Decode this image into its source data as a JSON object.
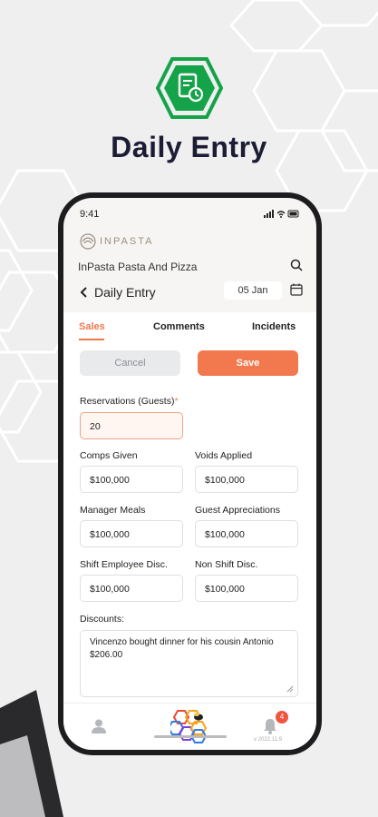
{
  "hero": {
    "title": "Daily Entry",
    "icon": "document-clock-icon",
    "accent_color": "#15a34a"
  },
  "status_bar": {
    "time": "9:41",
    "system_icons": "signal-wifi-battery"
  },
  "brand": {
    "name": "INPASTA",
    "logo": "inpasta-logo"
  },
  "header": {
    "restaurant_name": "InPasta Pasta And Pizza",
    "search_icon": "search-icon"
  },
  "nav": {
    "back_icon": "chevron-left-icon",
    "title": "Daily Entry",
    "date": "05 Jan",
    "calendar_icon": "calendar-icon"
  },
  "tabs": [
    {
      "label": "Sales",
      "active": true
    },
    {
      "label": "Comments",
      "active": false
    },
    {
      "label": "Incidents",
      "active": false
    }
  ],
  "actions": {
    "cancel_label": "Cancel",
    "save_label": "Save"
  },
  "form": {
    "reservations_label": "Reservations (Guests)",
    "reservations_required": "*",
    "reservations_value": "20",
    "comps_label": "Comps Given",
    "comps_value": "$100,000",
    "voids_label": "Voids Applied",
    "voids_value": "$100,000",
    "manager_label": "Manager Meals",
    "manager_value": "$100,000",
    "guest_label": "Guest Appreciations",
    "guest_value": "$100,000",
    "shift_label": "Shift Employee Disc.",
    "shift_value": "$100,000",
    "nonshift_label": "Non Shift Disc.",
    "nonshift_value": "$100,000",
    "discounts_label": "Discounts:",
    "discounts_value": "Vincenzo bought dinner for his cousin Antonio $206.00"
  },
  "bottom_nav": {
    "user_icon": "user-icon",
    "app_logo": "hexagon-cluster-logo",
    "bell_icon": "bell-icon",
    "notification_count": "4"
  },
  "version": "v 2022.11.9",
  "colors": {
    "accent": "#f2784d",
    "brand_green": "#15a34a",
    "title": "#1c1c34"
  }
}
